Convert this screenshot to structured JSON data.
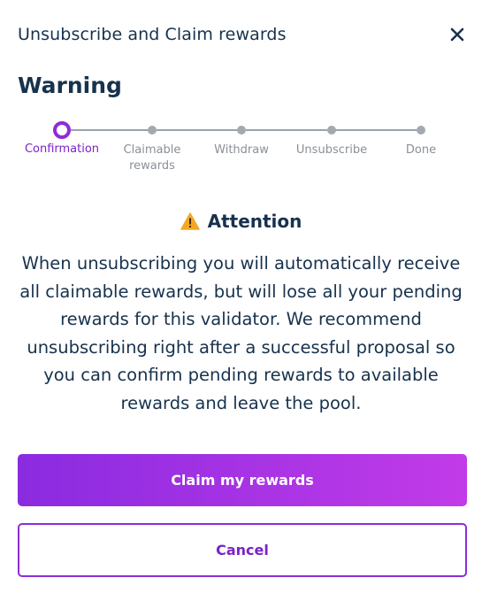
{
  "dialog": {
    "title": "Unsubscribe and Claim rewards",
    "close_icon": "close-icon"
  },
  "section": {
    "heading": "Warning"
  },
  "stepper": {
    "active_index": 0,
    "steps": [
      {
        "label": "Confirmation",
        "state": "active"
      },
      {
        "label": "Claimable rewards",
        "state": "pending"
      },
      {
        "label": "Withdraw",
        "state": "pending"
      },
      {
        "label": "Unsubscribe",
        "state": "pending"
      },
      {
        "label": "Done",
        "state": "pending"
      }
    ]
  },
  "attention": {
    "icon": "warning-triangle-icon",
    "title": "Attention",
    "message": "When unsubscribing you will automatically receive all claimable rewards, but will lose all your pending rewards for this validator. We recommend unsubscribing right after a successful proposal so you can confirm pending rewards to available rewards and leave the pool."
  },
  "actions": {
    "primary_label": "Claim my rewards",
    "secondary_label": "Cancel"
  },
  "colors": {
    "accent": "#8f2bd9",
    "gradient_start": "#8a2be0",
    "gradient_end": "#c23be8",
    "text": "#17324d",
    "warning": "#f5a623"
  }
}
